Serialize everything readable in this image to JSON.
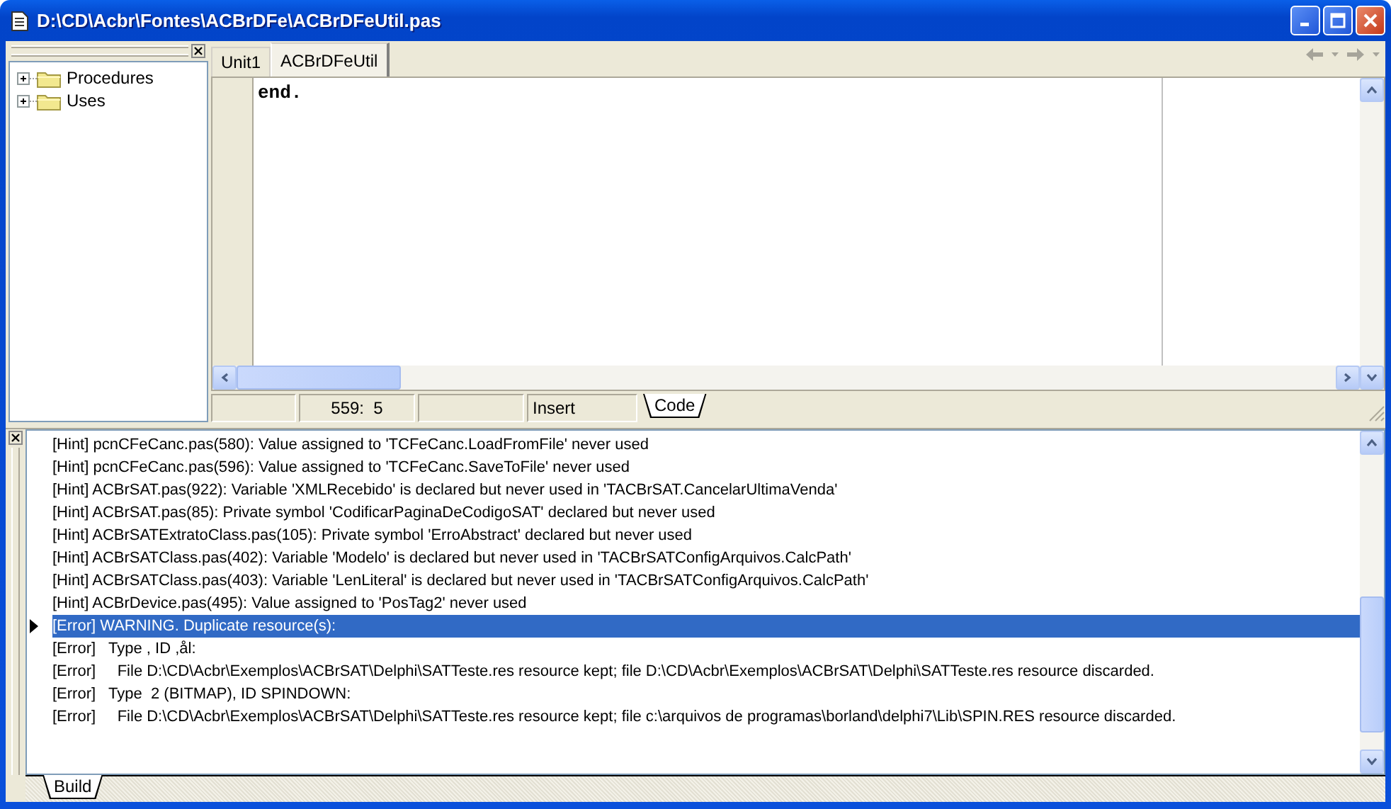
{
  "window": {
    "title": "D:\\CD\\Acbr\\Fontes\\ACBrDFe\\ACBrDFeUtil.pas"
  },
  "explorer": {
    "items": [
      {
        "label": "Procedures",
        "expanded": false
      },
      {
        "label": "Uses",
        "expanded": false
      }
    ]
  },
  "editor": {
    "tabs": [
      {
        "label": "Unit1",
        "selected": false
      },
      {
        "label": "ACBrDFeUtil",
        "selected": true
      }
    ],
    "lines": [
      "end."
    ],
    "status_bar": {
      "position": "559:  5",
      "mode": "Insert"
    },
    "view_tabs": [
      {
        "label": "Code",
        "selected": true
      }
    ]
  },
  "messages": {
    "items": [
      {
        "text": "[Hint] pcnCFeCanc.pas(580): Value assigned to 'TCFeCanc.LoadFromFile' never used",
        "selected": false
      },
      {
        "text": "[Hint] pcnCFeCanc.pas(596): Value assigned to 'TCFeCanc.SaveToFile' never used",
        "selected": false
      },
      {
        "text": "[Hint] ACBrSAT.pas(922): Variable 'XMLRecebido' is declared but never used in 'TACBrSAT.CancelarUltimaVenda'",
        "selected": false
      },
      {
        "text": "[Hint] ACBrSAT.pas(85): Private symbol 'CodificarPaginaDeCodigoSAT' declared but never used",
        "selected": false
      },
      {
        "text": "[Hint] ACBrSATExtratoClass.pas(105): Private symbol 'ErroAbstract' declared but never used",
        "selected": false
      },
      {
        "text": "[Hint] ACBrSATClass.pas(402): Variable 'Modelo' is declared but never used in 'TACBrSATConfigArquivos.CalcPath'",
        "selected": false
      },
      {
        "text": "[Hint] ACBrSATClass.pas(403): Variable 'LenLiteral' is declared but never used in 'TACBrSATConfigArquivos.CalcPath'",
        "selected": false
      },
      {
        "text": "[Hint] ACBrDevice.pas(495): Value assigned to 'PosTag2' never used",
        "selected": false
      },
      {
        "text": "[Error] WARNING. Duplicate resource(s):",
        "selected": true
      },
      {
        "text": "[Error]   Type , ID ,ål:",
        "selected": false
      },
      {
        "text": "[Error]     File D:\\CD\\Acbr\\Exemplos\\ACBrSAT\\Delphi\\SATTeste.res resource kept; file D:\\CD\\Acbr\\Exemplos\\ACBrSAT\\Delphi\\SATTeste.res resource discarded.",
        "selected": false
      },
      {
        "text": "[Error]   Type  2 (BITMAP), ID SPINDOWN:",
        "selected": false
      },
      {
        "text": "[Error]     File D:\\CD\\Acbr\\Exemplos\\ACBrSAT\\Delphi\\SATTeste.res resource kept; file c:\\arquivos de programas\\borland\\delphi7\\Lib\\SPIN.RES resource discarded.",
        "selected": false
      }
    ],
    "tabs": [
      {
        "label": "Build",
        "selected": true
      }
    ]
  }
}
